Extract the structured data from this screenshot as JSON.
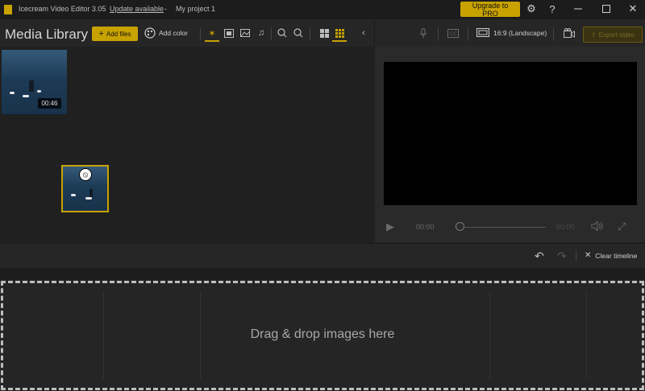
{
  "window": {
    "app_name": "Icecream Video Editor 3.05",
    "update_link": "Update available",
    "separator": "-",
    "project_name": "My project 1",
    "upgrade_label": "Upgrade to PRO"
  },
  "library": {
    "title": "Media Library",
    "add_files_label": "Add files",
    "add_color_label": "Add color",
    "items": [
      {
        "duration": "00:46"
      }
    ]
  },
  "preview": {
    "aspect_ratio_label": "16:9 (Landscape)",
    "export_label": "Export video",
    "current_time": "00:00",
    "total_time": "00:00"
  },
  "timeline": {
    "clear_label": "Clear timeline",
    "dropzone_text": "Drag & drop images here"
  },
  "colors": {
    "accent": "#c8a200",
    "background": "#232323"
  },
  "icons": {
    "settings": "gear-icon",
    "help": "help-icon",
    "minimize": "minimize-icon",
    "maximize": "maximize-icon",
    "close": "close-icon"
  }
}
